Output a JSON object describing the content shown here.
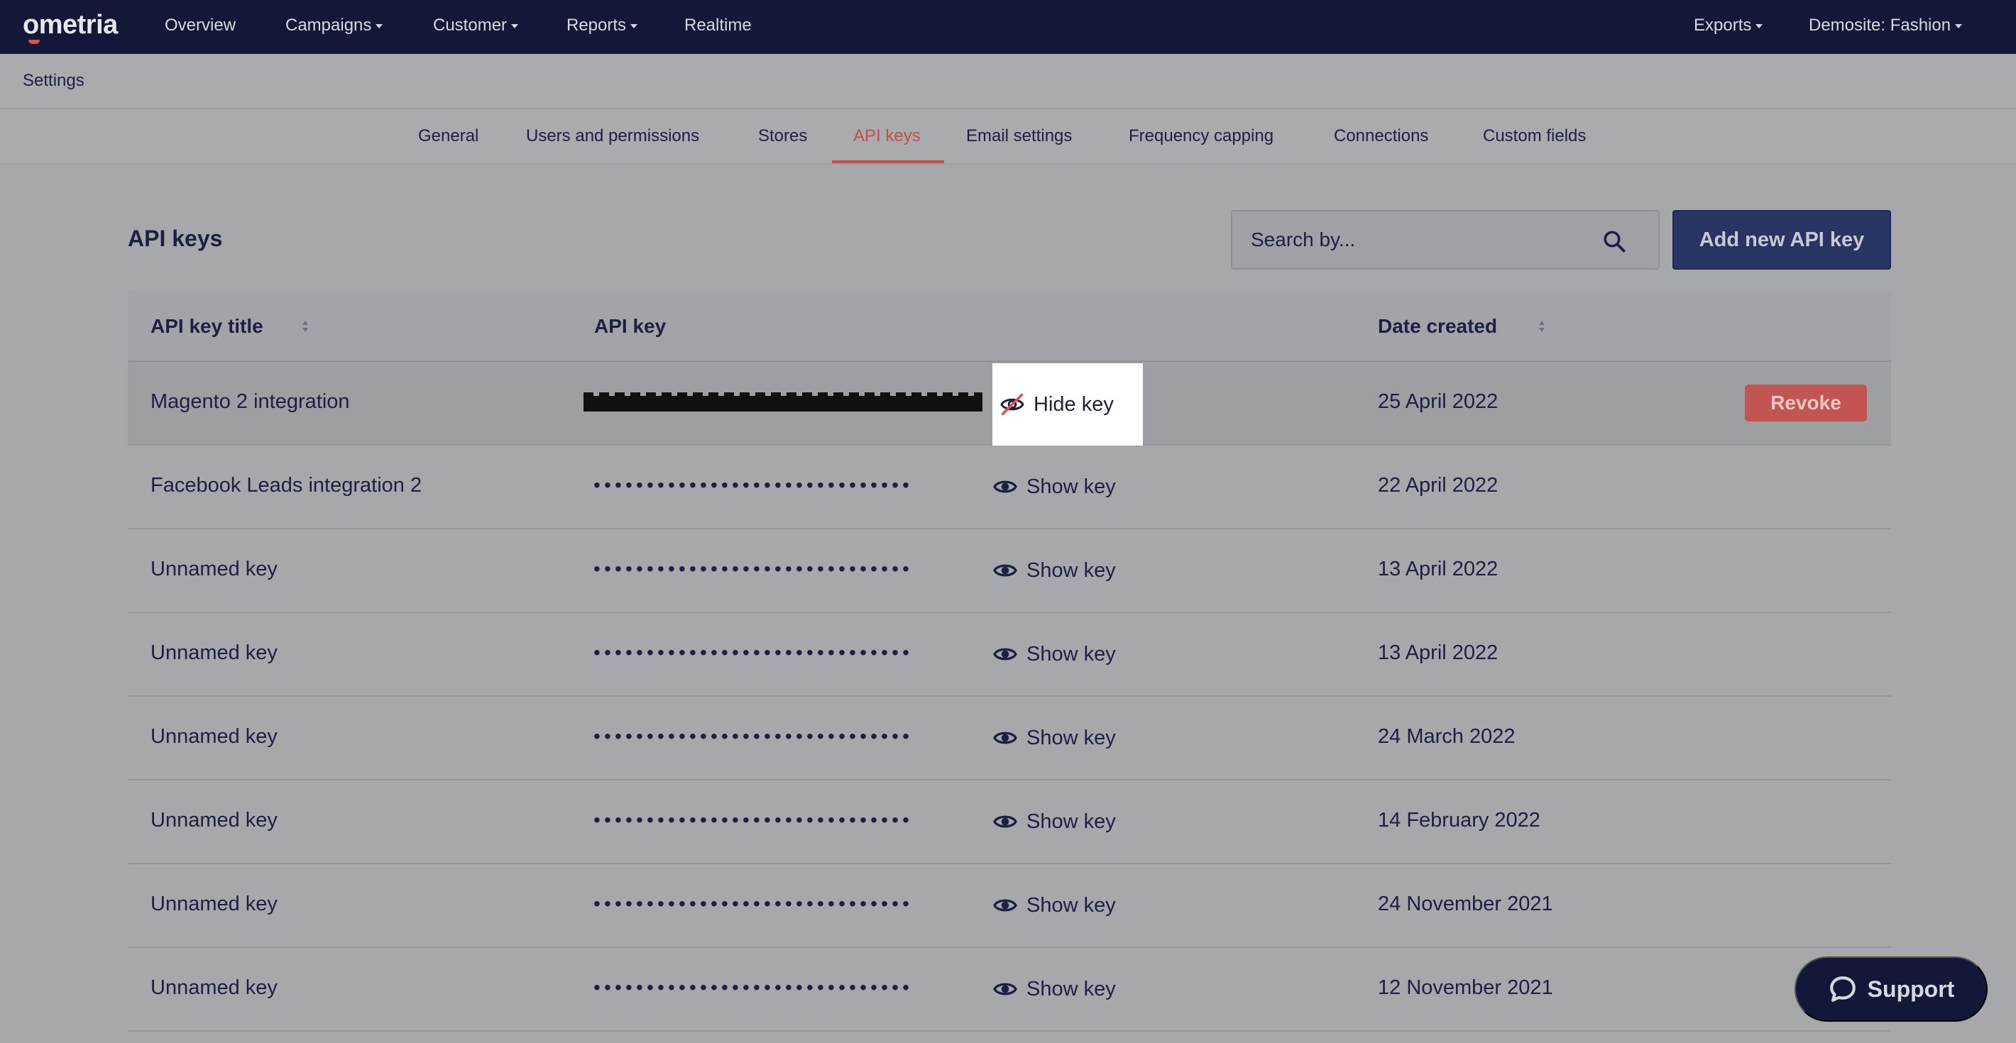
{
  "nav": {
    "logo": "ometria",
    "items": [
      "Overview",
      "Campaigns",
      "Customer",
      "Reports",
      "Realtime"
    ],
    "right": [
      "Exports",
      "Demosite: Fashion"
    ]
  },
  "settings": {
    "label": "Settings"
  },
  "tabs": [
    "General",
    "Users and permissions",
    "Stores",
    "API keys",
    "Email settings",
    "Frequency capping",
    "Connections",
    "Custom fields"
  ],
  "page": {
    "title": "API keys"
  },
  "search": {
    "placeholder": "Search by..."
  },
  "add_button": "Add new API key",
  "table": {
    "headers": [
      "API key title",
      "API key",
      "Date created"
    ],
    "rows": [
      {
        "title": "Magento 2 integration",
        "key": "",
        "action": "Hide key",
        "date": "25 April 2022",
        "revoke": "Revoke"
      },
      {
        "title": "Facebook Leads integration 2",
        "key": "••••••••••••••••••••••••••••••",
        "action": "Show key",
        "date": "22 April 2022"
      },
      {
        "title": "Unnamed key",
        "key": "••••••••••••••••••••••••••••••",
        "action": "Show key",
        "date": "13 April 2022"
      },
      {
        "title": "Unnamed key",
        "key": "••••••••••••••••••••••••••••••",
        "action": "Show key",
        "date": "13 April 2022"
      },
      {
        "title": "Unnamed key",
        "key": "••••••••••••••••••••••••••••••",
        "action": "Show key",
        "date": "24 March 2022"
      },
      {
        "title": "Unnamed key",
        "key": "••••••••••••••••••••••••••••••",
        "action": "Show key",
        "date": "14 February 2022"
      },
      {
        "title": "Unnamed key",
        "key": "••••••••••••••••••••••••••••••",
        "action": "Show key",
        "date": "24 November 2021"
      },
      {
        "title": "Unnamed key",
        "key": "••••••••••••••••••••••••••••••",
        "action": "Show key",
        "date": "12 November 2021"
      }
    ]
  },
  "support": "Support",
  "colors": {
    "nav_bg": "#131838",
    "accent": "#c0504d",
    "primary_button": "#283461"
  }
}
